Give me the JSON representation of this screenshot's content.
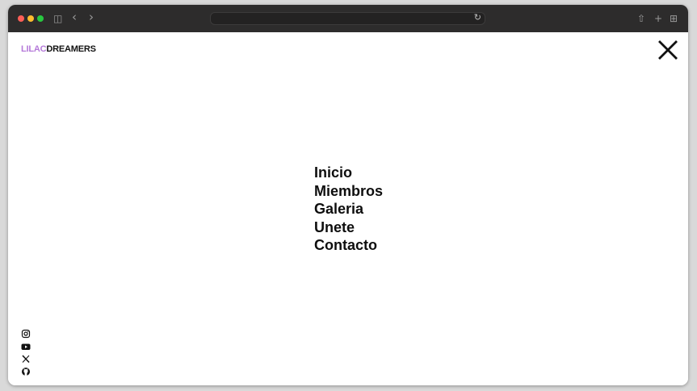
{
  "browser": {
    "address": "",
    "icons": [
      "sidebar-icon",
      "back-icon",
      "forward-icon",
      "reload-icon",
      "share-icon",
      "new-tab-icon",
      "tab-overview-icon"
    ],
    "glyphs": {
      "sidebar": "◫",
      "back": "‹",
      "forward": "›",
      "reload": "↻",
      "share": "⇧",
      "new_tab": "+",
      "tabs": "⊞"
    },
    "colors": {
      "titlebar": "#2d2c2c",
      "close": "#fe5f57",
      "minimize": "#febc2e",
      "zoom": "#28c840"
    }
  },
  "header": {
    "logo_part1": "LILAC",
    "logo_part2": "DREAMERS",
    "logo_accent_color": "#b57ad9",
    "close_icon": "close-icon"
  },
  "nav": {
    "items": [
      {
        "label": "Inicio"
      },
      {
        "label": "Miembros"
      },
      {
        "label": "Galeria"
      },
      {
        "label": "Unete"
      },
      {
        "label": "Contacto"
      }
    ]
  },
  "social": {
    "icons": [
      "instagram-icon",
      "youtube-icon",
      "x-icon",
      "github-icon"
    ]
  }
}
